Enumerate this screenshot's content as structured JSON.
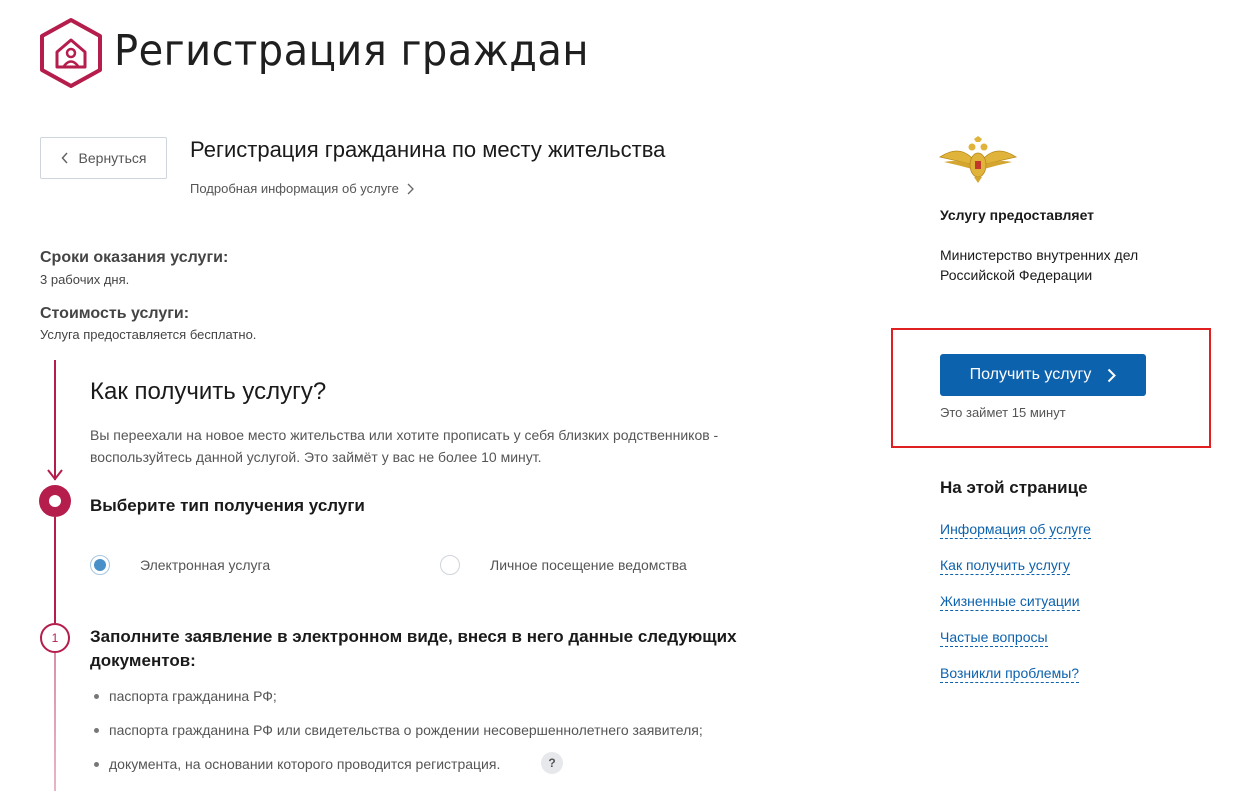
{
  "header": {
    "site_title": "Регистрация граждан",
    "logo_icon": "house-person-hexagon-icon"
  },
  "back_button": {
    "label": "Вернуться"
  },
  "service": {
    "title": "Регистрация гражданина по месту жительства",
    "info_link": "Подробная информация об услуге"
  },
  "term": {
    "label": "Сроки оказания услуги:",
    "value": "3 рабочих дня."
  },
  "cost": {
    "label": "Стоимость услуги:",
    "value": "Услуга предоставляется бесплатно."
  },
  "how": {
    "title": "Как получить услугу?",
    "description": "Вы переехали на новое место жительства или хотите прописать у себя близких родственников - воспользуйтесь данной услугой. Это займёт у вас не более 10 минут."
  },
  "step_choose": {
    "title": "Выберите тип получения услуги",
    "options": [
      {
        "label": "Электронная услуга",
        "selected": true
      },
      {
        "label": "Личное посещение ведомства",
        "selected": false
      }
    ]
  },
  "step_fill": {
    "number": "1",
    "title": "Заполните заявление в электронном виде, внеся в него данные следующих документов:",
    "documents": [
      "паспорта гражданина РФ;",
      "паспорта гражданина РФ или свидетельства о рождении несовершеннолетнего заявителя;",
      "документа, на основании которого проводится регистрация."
    ],
    "help_label": "?"
  },
  "provider": {
    "label": "Услугу предоставляет",
    "name": "Министерство внутренних дел Российской Федерации",
    "emblem_icon": "double-headed-eagle-emblem-icon"
  },
  "cta": {
    "button_label": "Получить услугу",
    "time_note": "Это займет 15 минут"
  },
  "on_page": {
    "title": "На этой странице",
    "links": [
      "Информация об услуге",
      "Как получить услугу",
      "Жизненные ситуации",
      "Частые вопросы",
      "Возникли проблемы?"
    ]
  },
  "colors": {
    "brand": "#b51d4c",
    "primary_button": "#0d62ad",
    "link": "#0d62ad",
    "highlight": "#e02020"
  }
}
